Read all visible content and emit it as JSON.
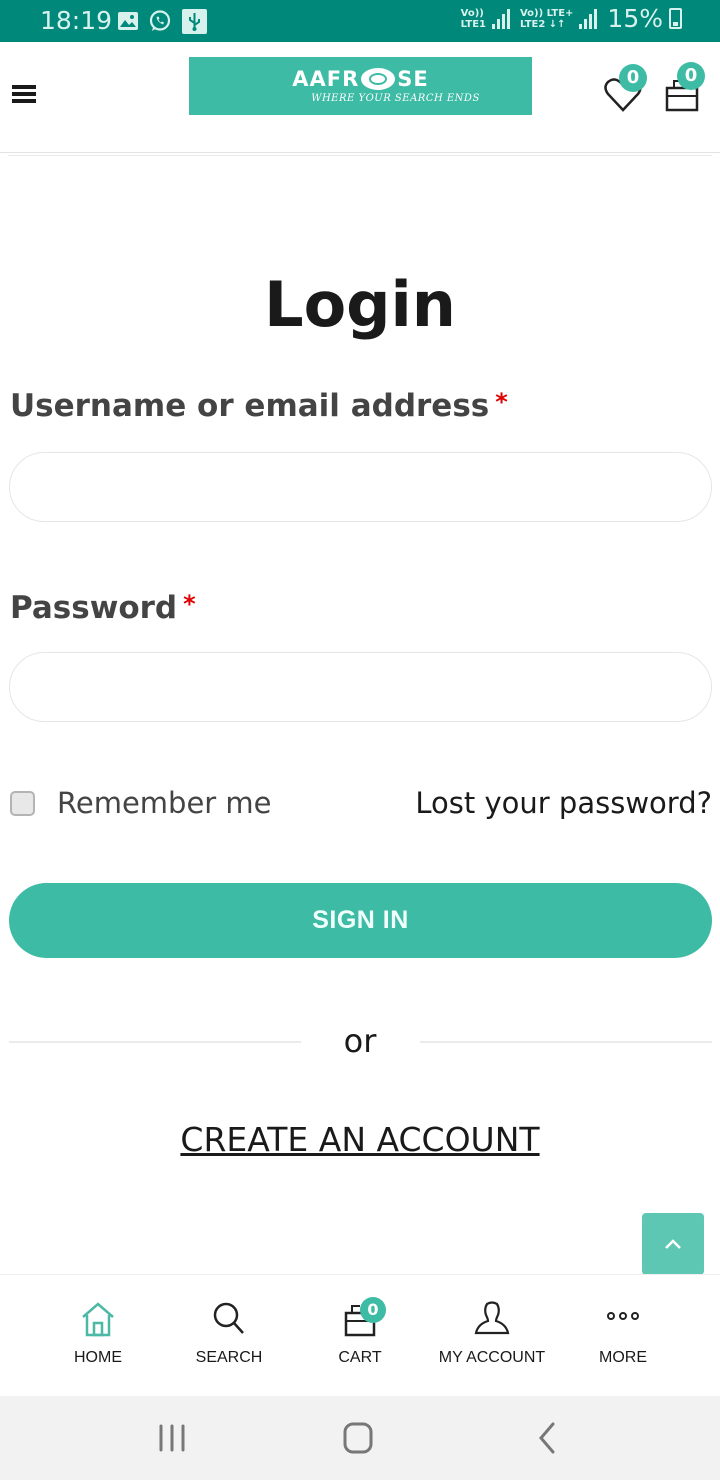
{
  "status_bar": {
    "time": "18:19",
    "left_icons": [
      "gallery-icon",
      "whatsapp-icon",
      "usb-icon"
    ],
    "sim1": {
      "line1": "Vo))",
      "line2": "LTE1"
    },
    "sim2": {
      "line1": "Vo)) LTE+",
      "line2": "LTE2 ↓↑"
    },
    "battery_percent": "15%",
    "battery_state": "charging"
  },
  "header": {
    "menu_icon": "hamburger-icon",
    "logo": {
      "brand_left": "AAFR",
      "brand_right": "SE",
      "tagline": "WHERE YOUR SEARCH ENDS"
    },
    "wishlist": {
      "icon": "heart-icon",
      "count": "0"
    },
    "cart": {
      "icon": "shopping-bag-icon",
      "count": "0"
    }
  },
  "login": {
    "title": "Login",
    "username": {
      "label": "Username or email address",
      "required_mark": "*",
      "value": "",
      "placeholder": ""
    },
    "password": {
      "label": "Password",
      "required_mark": "*",
      "value": "",
      "placeholder": ""
    },
    "remember_me": {
      "label": "Remember me",
      "checked": false
    },
    "lost_password": "Lost your password?",
    "sign_in": "SIGN IN",
    "or": "or",
    "create_account": "CREATE AN ACCOUNT"
  },
  "scroll_top": {
    "icon": "chevron-up-icon"
  },
  "bottom_nav": {
    "items": [
      {
        "label": "HOME",
        "icon": "home-icon",
        "active": true
      },
      {
        "label": "SEARCH",
        "icon": "search-icon",
        "active": false
      },
      {
        "label": "CART",
        "icon": "shopping-bag-icon",
        "badge": "0",
        "active": false
      },
      {
        "label": "MY ACCOUNT",
        "icon": "user-icon",
        "active": false
      },
      {
        "label": "MORE",
        "icon": "more-dots-icon",
        "active": false
      }
    ]
  },
  "system_nav": [
    "recent-apps-icon",
    "home-button-icon",
    "back-icon"
  ],
  "colors": {
    "accent": "#3dbba4",
    "status_bar": "#00897b",
    "required": "#e00000",
    "text": "#1a1a1a",
    "label": "#444444"
  }
}
